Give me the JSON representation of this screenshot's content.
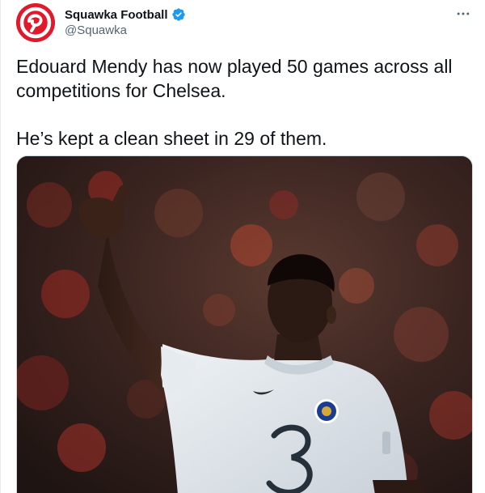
{
  "author": {
    "display_name": "Squawka Football",
    "handle": "@Squawka",
    "verified": true,
    "avatar_icon": "squawka-logo-icon",
    "brand_color": "#e1192a"
  },
  "tweet": {
    "paragraphs": [
      "Edouard Mendy has now played 50 games across all competitions for Chelsea.",
      "He’s kept a clean sheet in 29 of them."
    ]
  },
  "media": {
    "icon": "photo-goalkeeper-thumbs-up",
    "accent_colors": {
      "crowd_red": "#9e2a24",
      "kit": "#dde4ea",
      "crest": "#1a3d8f"
    }
  },
  "icons": {
    "verified": "verified-badge-icon",
    "more": "more-options-icon"
  },
  "colors": {
    "text": "#0f1419",
    "secondary": "#536471",
    "verified_blue": "#1d9bf0"
  }
}
